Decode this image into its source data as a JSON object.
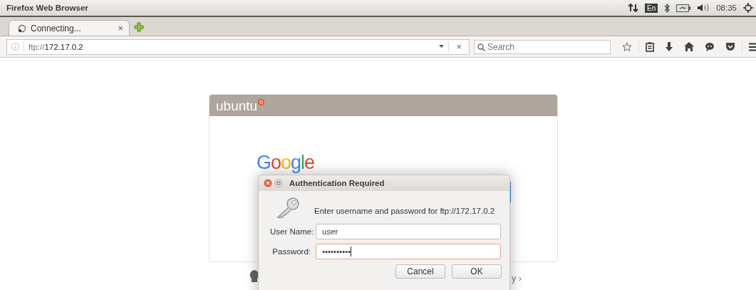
{
  "window": {
    "title": "Firefox Web Browser"
  },
  "tray": {
    "keyboard": "En",
    "time": "08:35"
  },
  "tabs": [
    {
      "label": "Connecting...",
      "close": "×",
      "selected": true
    }
  ],
  "address": {
    "url": "ftp://**172.17.0.2**",
    "clear": "×"
  },
  "search": {
    "placeholder": "Search"
  },
  "page": {
    "brand": "ubuntu",
    "logo": "Google",
    "link_fragment": "y ›"
  },
  "dialog": {
    "title": "Authentication Required",
    "message": "Enter username and password for ftp://172.17.0.2",
    "fields": [
      {
        "label": "User Name:",
        "value": "user",
        "focused": false
      },
      {
        "label": "Password:",
        "value": "••••••••••",
        "focused": true
      }
    ],
    "buttons": [
      "Cancel",
      "OK"
    ]
  }
}
